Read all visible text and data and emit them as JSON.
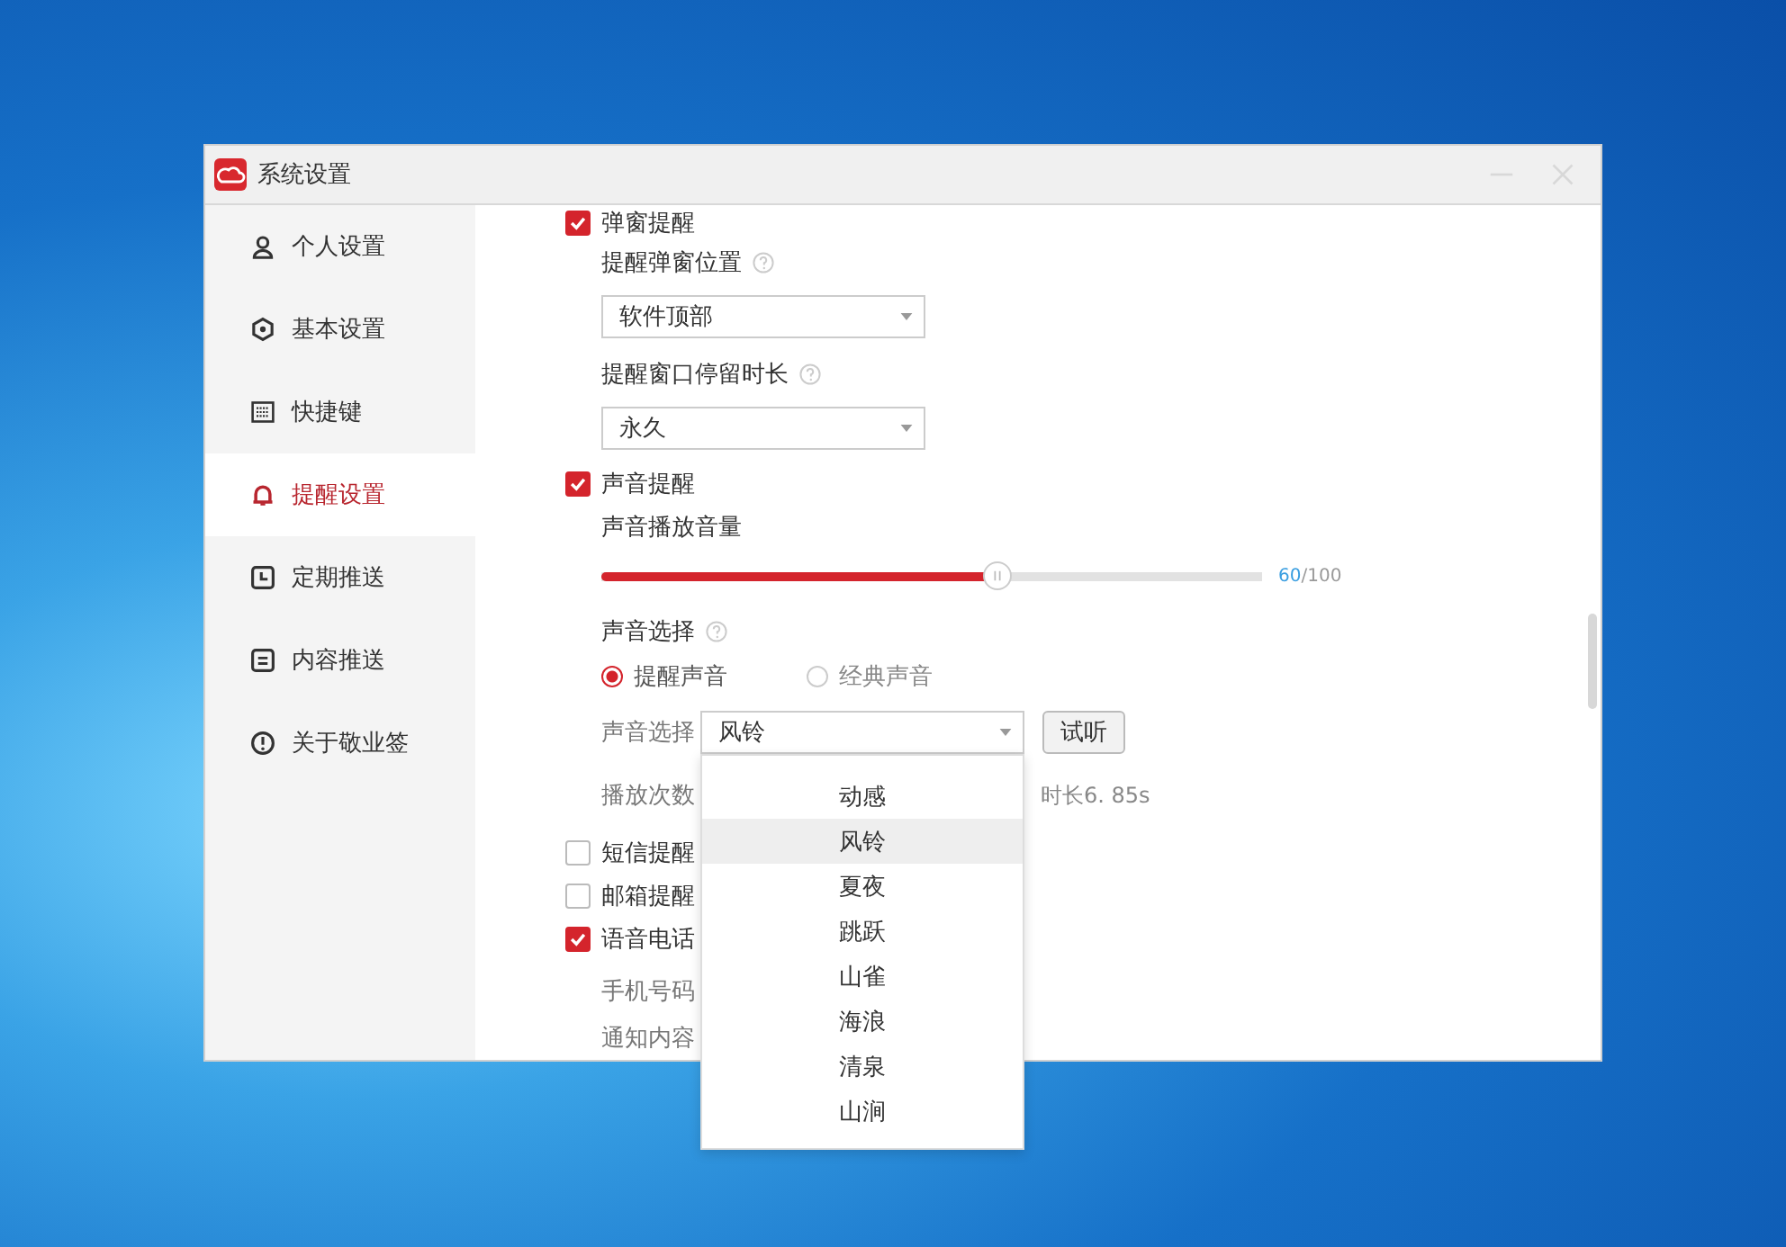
{
  "window": {
    "title": "系统设置"
  },
  "sidebar": {
    "items": [
      {
        "label": "个人设置",
        "selected": false
      },
      {
        "label": "基本设置",
        "selected": false
      },
      {
        "label": "快捷键",
        "selected": false
      },
      {
        "label": "提醒设置",
        "selected": true
      },
      {
        "label": "定期推送",
        "selected": false
      },
      {
        "label": "内容推送",
        "selected": false
      },
      {
        "label": "关于敬业签",
        "selected": false
      }
    ]
  },
  "content": {
    "rows": [
      {
        "kind": "check",
        "label": "弹窗提醒",
        "checked": true
      },
      {
        "kind": "label",
        "label": "提醒弹窗位置",
        "help": true
      },
      {
        "kind": "select",
        "value": "软件顶部"
      },
      {
        "kind": "label",
        "label": "提醒窗口停留时长",
        "help": true
      },
      {
        "kind": "select",
        "value": "永久"
      },
      {
        "kind": "check",
        "label": "声音提醒",
        "checked": true
      },
      {
        "kind": "label",
        "label": "声音播放音量"
      },
      {
        "kind": "slider",
        "level": 0.6,
        "value": "60",
        "max": "/100"
      },
      {
        "kind": "label",
        "label": "声音选择",
        "help": true
      },
      {
        "kind": "radios",
        "options": [
          {
            "label": "提醒声音",
            "selected": true
          },
          {
            "label": "经典声音",
            "selected": false
          }
        ]
      },
      {
        "kind": "sound",
        "label": "声音选择",
        "value": "风铃",
        "button": "试听",
        "menu": [
          {
            "label": "动感",
            "selected": false
          },
          {
            "label": "风铃",
            "selected": true
          },
          {
            "label": "夏夜",
            "selected": false
          },
          {
            "label": "跳跃",
            "selected": false
          },
          {
            "label": "山雀",
            "selected": false
          },
          {
            "label": "海浪",
            "selected": false
          },
          {
            "label": "清泉",
            "selected": false
          },
          {
            "label": "山涧",
            "selected": false
          }
        ]
      },
      {
        "kind": "plays",
        "label": "播放次数",
        "duration": "时长6. 85s"
      },
      {
        "kind": "check",
        "label": "短信提醒",
        "checked": false
      },
      {
        "kind": "check",
        "label": "邮箱提醒",
        "checked": false
      },
      {
        "kind": "check",
        "label": "语音电话",
        "checked": true
      },
      {
        "kind": "field",
        "label": "手机号码"
      },
      {
        "kind": "field",
        "label": "通知内容"
      }
    ]
  }
}
